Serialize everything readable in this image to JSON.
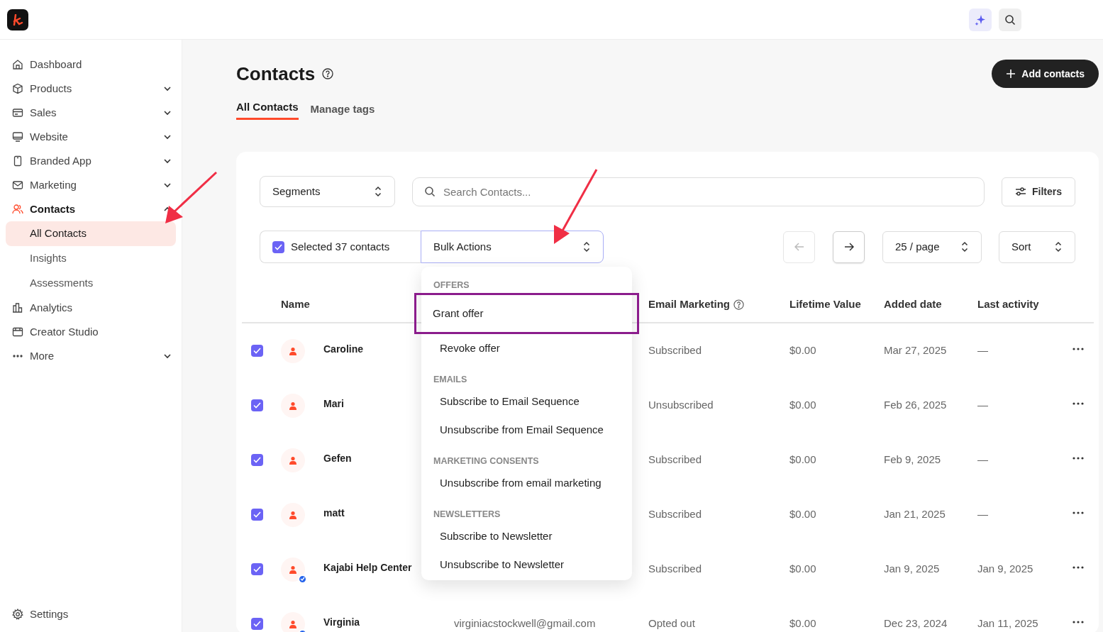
{
  "sidebar": {
    "items": [
      {
        "label": "Dashboard",
        "expandable": false,
        "selected": false
      },
      {
        "label": "Products",
        "expandable": true,
        "expanded": false,
        "selected": false
      },
      {
        "label": "Sales",
        "expandable": true,
        "expanded": false,
        "selected": false
      },
      {
        "label": "Website",
        "expandable": true,
        "expanded": false,
        "selected": false
      },
      {
        "label": "Branded App",
        "expandable": true,
        "expanded": false,
        "selected": false
      },
      {
        "label": "Marketing",
        "expandable": true,
        "expanded": false,
        "selected": false
      },
      {
        "label": "Contacts",
        "expandable": true,
        "expanded": true,
        "selected": true,
        "children": [
          {
            "label": "All Contacts",
            "selected": true
          },
          {
            "label": "Insights",
            "selected": false
          },
          {
            "label": "Assessments",
            "selected": false
          }
        ]
      },
      {
        "label": "Analytics",
        "expandable": false,
        "selected": false
      },
      {
        "label": "Creator Studio",
        "expandable": false,
        "selected": false
      },
      {
        "label": "More",
        "expandable": true,
        "expanded": false,
        "selected": false
      }
    ],
    "footer_item": {
      "label": "Settings"
    }
  },
  "page": {
    "title": "Contacts",
    "add_button": "Add contacts",
    "tabs": [
      {
        "label": "All Contacts",
        "selected": true
      },
      {
        "label": "Manage tags",
        "selected": false
      }
    ]
  },
  "toolbar": {
    "segments": "Segments",
    "search": {
      "placeholder": "Search Contacts..."
    },
    "filters": "Filters",
    "selection": {
      "label": "Selected 37 contacts",
      "checked": true
    },
    "bulk_actions": "Bulk Actions",
    "prev": {
      "disabled": true
    },
    "next": {
      "disabled": false
    },
    "per_page": "25 / page",
    "sort": "Sort"
  },
  "bulk_menu": {
    "sections": [
      {
        "heading": "OFFERS",
        "items": [
          {
            "label": "Grant offer",
            "outlined": true
          },
          {
            "label": "Revoke offer",
            "outlined": false
          }
        ]
      },
      {
        "heading": "EMAILS",
        "items": [
          {
            "label": "Subscribe to Email Sequence",
            "outlined": false
          },
          {
            "label": "Unsubscribe from Email Sequence",
            "outlined": false
          }
        ]
      },
      {
        "heading": "MARKETING CONSENTS",
        "items": [
          {
            "label": "Unsubscribe from email marketing",
            "outlined": false
          }
        ]
      },
      {
        "heading": "NEWSLETTERS",
        "items": [
          {
            "label": "Subscribe to Newsletter",
            "outlined": false
          },
          {
            "label": "Unsubscribe to Newsletter",
            "outlined": false
          }
        ]
      }
    ]
  },
  "table": {
    "columns": [
      "Name",
      "Email Marketing",
      "Lifetime Value",
      "Added date",
      "Last activity"
    ],
    "rows": [
      {
        "checked": true,
        "verified": false,
        "name": "Caroline",
        "email_marketing": "Subscribed",
        "lifetime_value": "$0.00",
        "added_date": "Mar 27, 2025",
        "last_activity": "—"
      },
      {
        "checked": true,
        "verified": false,
        "name": "Mari",
        "email_marketing": "Unsubscribed",
        "lifetime_value": "$0.00",
        "added_date": "Feb 26, 2025",
        "last_activity": "—"
      },
      {
        "checked": true,
        "verified": false,
        "name": "Gefen",
        "email_marketing": "Subscribed",
        "lifetime_value": "$0.00",
        "added_date": "Feb 9, 2025",
        "last_activity": "—"
      },
      {
        "checked": true,
        "verified": false,
        "name": "matt",
        "email_marketing": "Subscribed",
        "lifetime_value": "$0.00",
        "added_date": "Jan 21, 2025",
        "last_activity": "—"
      },
      {
        "checked": true,
        "verified": true,
        "name": "Kajabi Help Center",
        "email_marketing": "Subscribed",
        "lifetime_value": "$0.00",
        "added_date": "Jan 9, 2025",
        "last_activity": "Jan 9, 2025"
      },
      {
        "checked": true,
        "verified": true,
        "name": "Virginia",
        "email": "virginiacstockwell@gmail.com",
        "email_marketing": "Opted out",
        "lifetime_value": "$0.00",
        "added_date": "Dec 23, 2024",
        "last_activity": "Jan 11, 2025"
      }
    ]
  }
}
